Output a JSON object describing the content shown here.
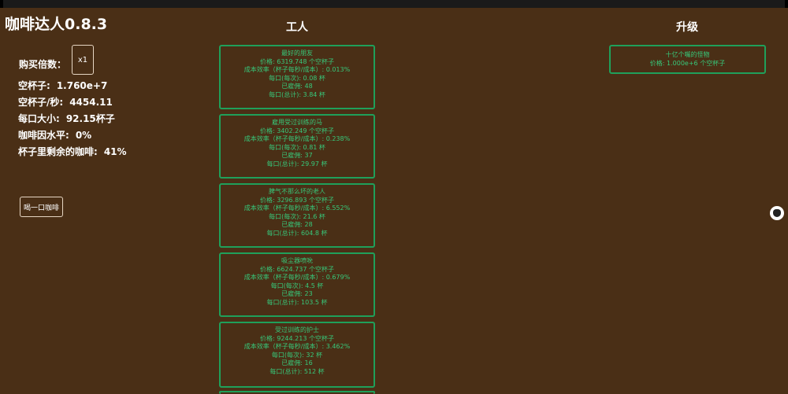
{
  "app": {
    "title": "咖啡达人0.8.3"
  },
  "buy": {
    "label": "购买倍数：",
    "multiplier": "x1"
  },
  "stats": [
    {
      "label": "空杯子:",
      "value": "1.760e+7"
    },
    {
      "label": "空杯子/秒:",
      "value": "4454.11"
    },
    {
      "label": "每口大小:",
      "value": "92.15杯子"
    },
    {
      "label": "咖啡因水平:",
      "value": "0%"
    },
    {
      "label": "杯子里剩余的咖啡:",
      "value": "41%"
    }
  ],
  "drink_button": "喝一口咖啡",
  "workers": {
    "heading": "工人",
    "items": [
      {
        "name": "最好的朋友",
        "price": "价格: 6319.748 个空杯子",
        "efficiency": "成本效率（杯子每秒/成本）: 0.013%",
        "per_sip": "每口(每次): 0.08 杯",
        "hired": "已雇佣: 48",
        "total": "每口(总计): 3.84 杯"
      },
      {
        "name": "雇用受过训练的马",
        "price": "价格: 3402.249 个空杯子",
        "efficiency": "成本效率（杯子每秒/成本）: 0.238%",
        "per_sip": "每口(每次): 0.81 杯",
        "hired": "已雇佣: 37",
        "total": "每口(总计): 29.97 杯"
      },
      {
        "name": "脾气不那么坏的老人",
        "price": "价格: 3296.893 个空杯子",
        "efficiency": "成本效率（杯子每秒/成本）: 6.552%",
        "per_sip": "每口(每次): 21.6 杯",
        "hired": "已雇佣: 28",
        "total": "每口(总计): 604.8 杯"
      },
      {
        "name": "吸尘器喷吮",
        "price": "价格: 6624.737 个空杯子",
        "efficiency": "成本效率（杯子每秒/成本）: 0.679%",
        "per_sip": "每口(每次): 4.5 杯",
        "hired": "已雇佣: 23",
        "total": "每口(总计): 103.5 杯"
      },
      {
        "name": "受过训练的护士",
        "price": "价格: 9244.213 个空杯子",
        "efficiency": "成本效率（杯子每秒/成本）: 3.462%",
        "per_sip": "每口(每次): 32 杯",
        "hired": "已雇佣: 16",
        "total": "每口(总计): 512 杯"
      }
    ]
  },
  "upgrades": {
    "heading": "升级",
    "items": [
      {
        "name": "十亿个嘴的怪物",
        "price": "价格: 1.000e+6 个空杯子"
      }
    ]
  },
  "icons": {
    "avatar": "github-icon"
  },
  "colors": {
    "background": "#4a2f16",
    "card_border": "#1fa05a",
    "card_text": "#37c87a"
  }
}
